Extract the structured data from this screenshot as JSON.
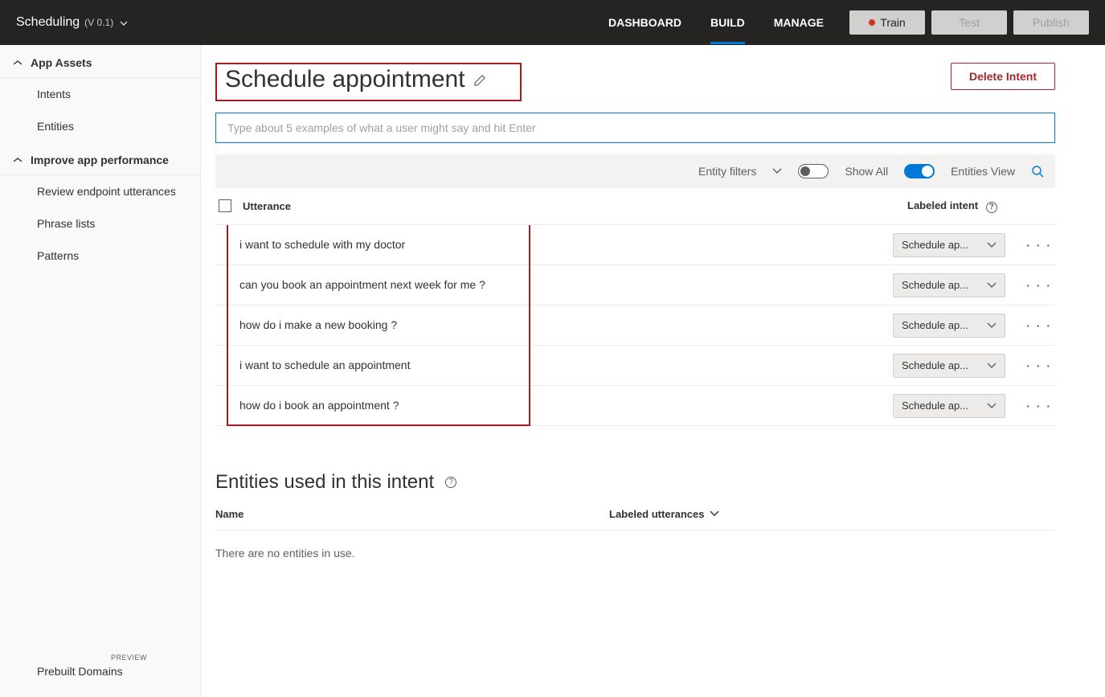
{
  "header": {
    "app_name": "Scheduling",
    "version": "(V 0.1)",
    "tabs": {
      "dashboard": "DASHBOARD",
      "build": "BUILD",
      "manage": "MANAGE"
    },
    "buttons": {
      "train": "Train",
      "test": "Test",
      "publish": "Publish"
    }
  },
  "sidebar": {
    "section1": "App Assets",
    "intents": "Intents",
    "entities": "Entities",
    "section2": "Improve app performance",
    "review": "Review endpoint utterances",
    "phrase": "Phrase lists",
    "patterns": "Patterns",
    "prebuilt": "Prebuilt Domains",
    "preview": "PREVIEW"
  },
  "page": {
    "title": "Schedule appointment",
    "delete": "Delete Intent",
    "placeholder": "Type about 5 examples of what a user might say and hit Enter"
  },
  "filterbar": {
    "entity_filters": "Entity filters",
    "show_all": "Show All",
    "entities_view": "Entities View"
  },
  "table": {
    "col_utterance": "Utterance",
    "col_intent": "Labeled intent",
    "intent_label": "Schedule ap...",
    "rows": [
      "i want to schedule with my doctor",
      "can you book an appointment next week for me ?",
      "how do i make a new booking ?",
      "i want to schedule an appointment",
      "how do i book an appointment ?"
    ]
  },
  "entities": {
    "title": "Entities used in this intent",
    "col_name": "Name",
    "col_labeled": "Labeled utterances",
    "empty": "There are no entities in use."
  }
}
